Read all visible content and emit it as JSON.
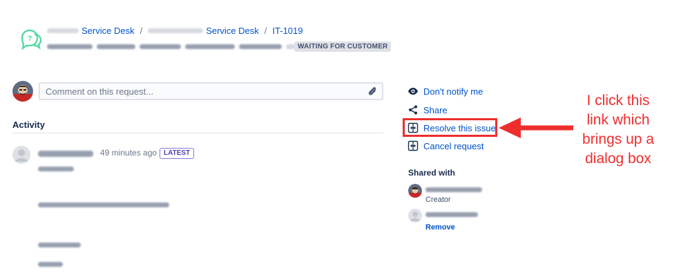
{
  "header": {
    "breadcrumb": {
      "project_label": "Service Desk",
      "service_desk_label": "Service Desk",
      "issue_key": "IT-1019"
    },
    "status": "WAITING FOR CUSTOMER"
  },
  "comment": {
    "placeholder": "Comment on this request..."
  },
  "activity": {
    "heading": "Activity",
    "entry": {
      "time": "49 minutes ago",
      "badge": "LATEST"
    }
  },
  "sidebar": {
    "actions": [
      {
        "label": "Don't notify me",
        "icon": "eye-icon"
      },
      {
        "label": "Share",
        "icon": "share-icon"
      },
      {
        "label": "Resolve this issue",
        "icon": "transition-icon"
      },
      {
        "label": "Cancel request",
        "icon": "transition-icon"
      }
    ],
    "shared_with": {
      "heading": "Shared with",
      "creator_role": "Creator",
      "remove_label": "Remove"
    }
  },
  "annotation": {
    "text": "I click this\nlink which\nbrings up a\ndialog box",
    "color": "#ee2d2d"
  },
  "colors": {
    "link": "#0052cc",
    "text": "#172b4d",
    "muted": "#6b778c",
    "lozenge_bg": "#dfe1e6",
    "latest_border": "#8777d9",
    "latest_text": "#5243aa"
  }
}
